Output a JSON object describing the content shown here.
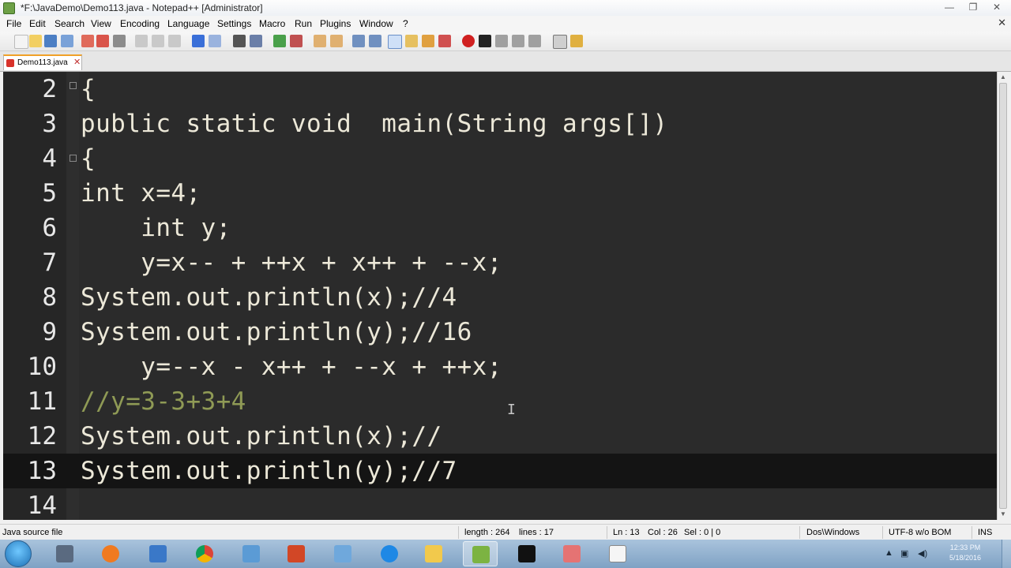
{
  "window": {
    "title": "*F:\\JavaDemo\\Demo113.java - Notepad++ [Administrator]",
    "controls": {
      "minimize": "—",
      "maximize": "❐",
      "close": "✕"
    }
  },
  "menu": {
    "items": [
      "File",
      "Edit",
      "Search",
      "View",
      "Encoding",
      "Language",
      "Settings",
      "Macro",
      "Run",
      "Plugins",
      "Window",
      "?"
    ],
    "doc_close": "✕"
  },
  "tab": {
    "label": "Demo113.java",
    "close": "✕"
  },
  "editor": {
    "lines": [
      {
        "number": "2",
        "code": "{"
      },
      {
        "number": "3",
        "code": "public static void  main(String args[])"
      },
      {
        "number": "4",
        "code": "{"
      },
      {
        "number": "5",
        "code": "int x=4;"
      },
      {
        "number": "6",
        "code": "    int y;"
      },
      {
        "number": "7",
        "code": "    y=x-- + ++x + x++ + --x;"
      },
      {
        "number": "8",
        "code": "System.out.println(x);//4"
      },
      {
        "number": "9",
        "code": "System.out.println(y);//16"
      },
      {
        "number": "10",
        "code": "    y=--x - x++ + --x + ++x;"
      },
      {
        "number": "11",
        "code": "//y=3-3+3+4"
      },
      {
        "number": "12",
        "code": "System.out.println(x);//"
      },
      {
        "number": "13",
        "code": "System.out.println(y);//7"
      },
      {
        "number": "14",
        "code": ""
      }
    ],
    "current_line": "13",
    "caret_glyph": "I"
  },
  "status": {
    "file_type": "Java source file",
    "length": "length : 264",
    "lines": "lines : 17",
    "ln": "Ln : 13",
    "col": "Col : 26",
    "sel": "Sel : 0 | 0",
    "eol": "Dos\\Windows",
    "encoding": "UTF-8 w/o BOM",
    "mode": "INS"
  },
  "taskbar": {
    "items": [
      "calculator",
      "media-player",
      "computer",
      "chrome",
      "network",
      "office",
      "tool",
      "internet-explorer",
      "folder",
      "notepad-plus-plus",
      "cmd",
      "paint",
      "notepad"
    ],
    "active": "notepad-plus-plus",
    "clock_time": "12:33 PM",
    "clock_date": "5/18/2016"
  },
  "colors": {
    "editor_bg": "#2b2b2b",
    "current_line_bg": "#141414",
    "code_fg": "#ece8d8",
    "line_number_fg": "#e8e8e8",
    "tab_accent": "#f0a028"
  }
}
